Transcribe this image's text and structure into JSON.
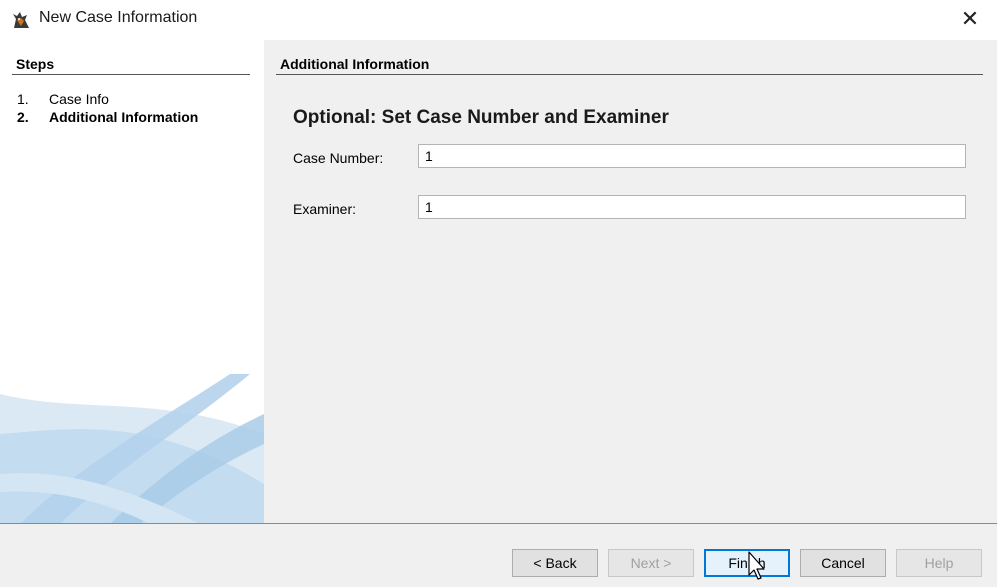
{
  "window": {
    "title": "New Case Information",
    "icon": "app-dog-icon",
    "close_label": "✕"
  },
  "steps": {
    "header": "Steps",
    "items": [
      {
        "num": "1.",
        "label": "Case Info",
        "active": false
      },
      {
        "num": "2.",
        "label": "Additional Information",
        "active": true
      }
    ]
  },
  "content": {
    "header": "Additional Information",
    "section_title": "Optional: Set Case Number and Examiner",
    "fields": {
      "case_number": {
        "label": "Case Number:",
        "value": "1"
      },
      "examiner": {
        "label": "Examiner:",
        "value": "1"
      }
    }
  },
  "buttons": {
    "back": "< Back",
    "next": "Next >",
    "finish": "Finish",
    "cancel": "Cancel",
    "help": "Help"
  },
  "colors": {
    "accent": "#0078d7",
    "panel_bg": "#f0f0f0",
    "swoosh": "#a9cbe6"
  }
}
